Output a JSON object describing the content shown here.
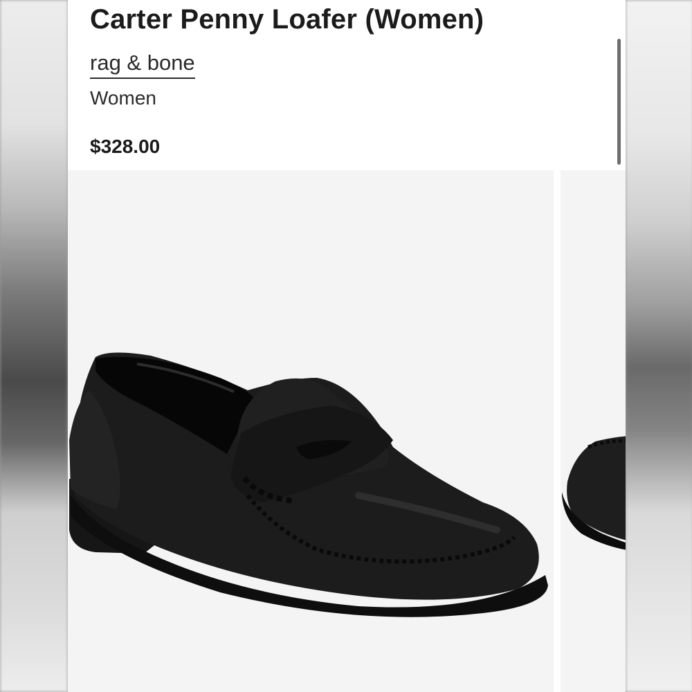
{
  "product": {
    "title": "Carter Penny Loafer (Women)",
    "brand": "rag & bone",
    "category": "Women",
    "price": "$328.00"
  },
  "gallery": {
    "images": [
      {
        "alt": "Black leather penny loafer, side view",
        "icon": "shoe-image"
      },
      {
        "alt": "Black leather penny loafer, partial view",
        "icon": "shoe-image"
      }
    ]
  },
  "colors": {
    "text": "#1b1b1b",
    "photo_bg": "#f4f4f4",
    "shoe": "#1c1c1c"
  }
}
